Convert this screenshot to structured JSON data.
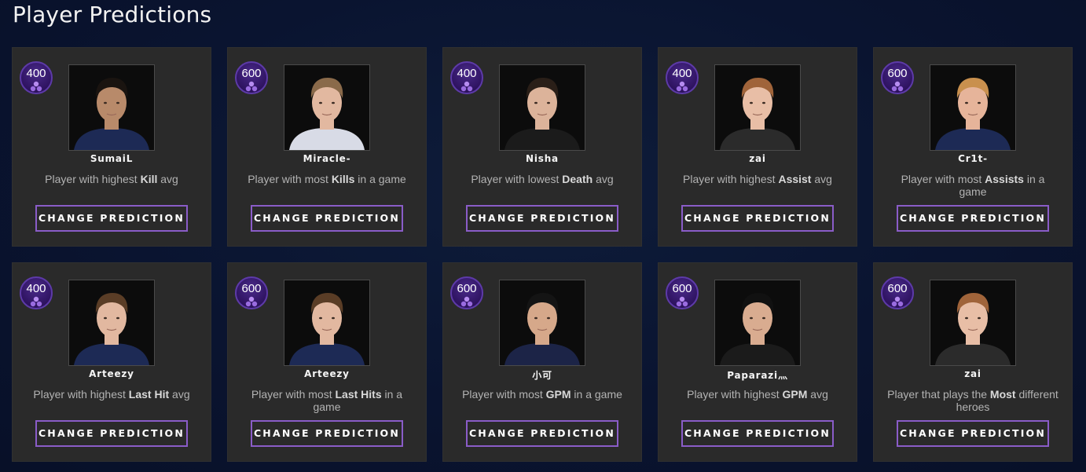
{
  "page": {
    "title": "Player Predictions"
  },
  "cards": [
    {
      "points": "400",
      "player": "SumaiL",
      "desc_pre": "Player with highest ",
      "desc_bold": "Kill",
      "desc_post": " avg",
      "button": "CHANGE PREDICTION",
      "shirt": "#1d2a55",
      "hair": "#1a1410",
      "skin": "#b88a6a"
    },
    {
      "points": "600",
      "player": "Miracle-",
      "desc_pre": "Player with most ",
      "desc_bold": "Kills",
      "desc_post": " in a game",
      "button": "CHANGE PREDICTION",
      "shirt": "#d8dbe6",
      "hair": "#8a6a4a",
      "skin": "#e2b8a0"
    },
    {
      "points": "400",
      "player": "Nisha",
      "desc_pre": "Player with lowest ",
      "desc_bold": "Death",
      "desc_post": " avg",
      "button": "CHANGE PREDICTION",
      "shirt": "#1b1b1b",
      "hair": "#2a1f18",
      "skin": "#dcb39a"
    },
    {
      "points": "400",
      "player": "zai",
      "desc_pre": "Player with highest ",
      "desc_bold": "Assist",
      "desc_post": " avg",
      "button": "CHANGE PREDICTION",
      "shirt": "#2b2b2b",
      "hair": "#a0643a",
      "skin": "#e8bea6"
    },
    {
      "points": "600",
      "player": "Cr1t-",
      "desc_pre": "Player with most ",
      "desc_bold": "Assists",
      "desc_post": " in a game",
      "button": "CHANGE PREDICTION",
      "shirt": "#1d2a55",
      "hair": "#c9904e",
      "skin": "#e6b49a"
    },
    {
      "points": "400",
      "player": "Arteezy",
      "desc_pre": "Player with highest ",
      "desc_bold": "Last Hit",
      "desc_post": " avg",
      "button": "CHANGE PREDICTION",
      "shirt": "#1d2a55",
      "hair": "#5a3d26",
      "skin": "#e2b8a0"
    },
    {
      "points": "600",
      "player": "Arteezy",
      "desc_pre": "Player with most ",
      "desc_bold": "Last Hits",
      "desc_post": " in a game",
      "button": "CHANGE PREDICTION",
      "shirt": "#1d2a55",
      "hair": "#5a3d26",
      "skin": "#e2b8a0"
    },
    {
      "points": "600",
      "player": "小可",
      "desc_pre": "Player with most ",
      "desc_bold": "GPM",
      "desc_post": " in a game",
      "button": "CHANGE PREDICTION",
      "shirt": "#1c2447",
      "hair": "#141414",
      "skin": "#d6a88a"
    },
    {
      "points": "600",
      "player": "Paparazi灬",
      "desc_pre": "Player with highest ",
      "desc_bold": "GPM",
      "desc_post": " avg",
      "button": "CHANGE PREDICTION",
      "shirt": "#1b1b1b",
      "hair": "#111111",
      "skin": "#d9ac90"
    },
    {
      "points": "600",
      "player": "zai",
      "desc_pre": "Player that plays the ",
      "desc_bold": "Most",
      "desc_post": " different heroes",
      "button": "CHANGE PREDICTION",
      "shirt": "#2b2b2b",
      "hair": "#a0643a",
      "skin": "#e8bea6"
    }
  ],
  "colors": {
    "accent": "#8a5cc8",
    "badge_bg": "#2e1360",
    "card_bg": "#2a2a2a"
  },
  "icons": {
    "badge": "shards-icon"
  }
}
